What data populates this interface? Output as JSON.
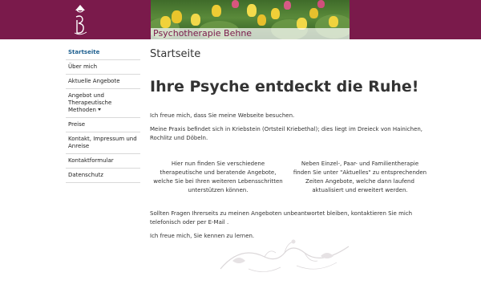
{
  "header": {
    "banner_title": "Psychotherapie Behne",
    "colors": {
      "brand": "#7a1a4b",
      "nav_active": "#1d5f8f"
    }
  },
  "sidebar": {
    "items": [
      {
        "label": "Startseite",
        "active": true
      },
      {
        "label": "Über mich"
      },
      {
        "label": "Aktuelle Angebote"
      },
      {
        "label": "Angebot und Therapeutische Methoden",
        "has_dropdown": true
      },
      {
        "label": "Preise"
      },
      {
        "label": "Kontakt, Impressum und Anreise"
      },
      {
        "label": "Kontaktformular"
      },
      {
        "label": "Datenschutz"
      }
    ]
  },
  "main": {
    "page_title": "Startseite",
    "headline": "Ihre Psyche entdeckt die Ruhe!",
    "intro": "Ich freue mich, dass Sie meine Webseite besuchen.",
    "location": "Meine Praxis befindet sich in Kriebstein (Ortsteil Kriebethal); dies liegt im Dreieck von Hainichen, Rochlitz und Döbeln.",
    "col_left": "Hier nun finden Sie verschiedene therapeutische und beratende Angebote, welche Sie bei Ihren weiteren Lebensschritten unterstützen können.",
    "col_right": "Neben Einzel-, Paar- und Familientherapie finden Sie unter \"Aktuelles\" zu entsprechenden Zeiten Angebote, welche dann laufend aktualisiert und erweitert werden.",
    "contact_note": "Sollten Fragen Ihrerseits zu meinen Angeboten unbeantwortet bleiben, kontaktieren Sie mich telefonisch oder per E-Mail .",
    "closing": "Ich freue mich, Sie kennen zu lernen."
  }
}
